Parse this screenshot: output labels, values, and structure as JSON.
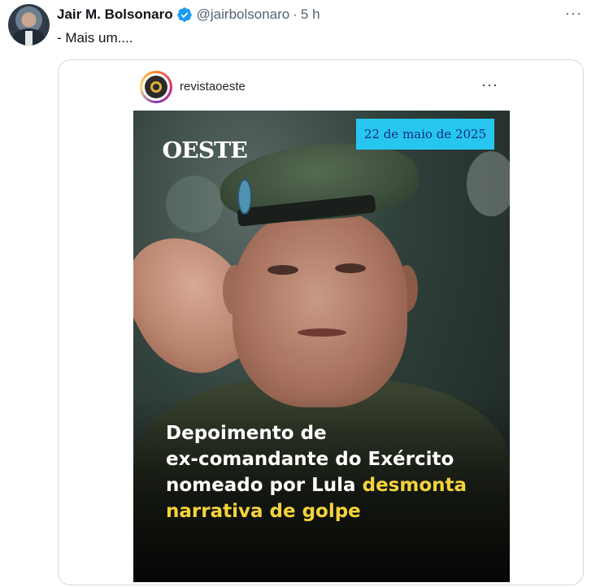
{
  "tweet": {
    "author_name": "Jair M. Bolsonaro",
    "handle": "@jairbolsonaro",
    "separator": "·",
    "time": "5 h",
    "more_label": "···",
    "text": "- Mais um...."
  },
  "embed": {
    "username": "revistaoeste",
    "more_label": "···",
    "image": {
      "date_label": "22 de maio de 2025",
      "logo_text": "OESTE",
      "headline_lines": [
        "Depoimento de",
        "ex-comandante do Exército",
        "nomeado por Lula"
      ],
      "headline_highlight_inline": "desmonta",
      "headline_highlight_line": "narrativa de golpe"
    }
  },
  "colors": {
    "verified": "#1d9bf0",
    "date_box": "#27c6f0",
    "headline_highlight": "#f5d33a"
  },
  "icons": [
    "verified-badge-icon",
    "more-options-icon"
  ]
}
